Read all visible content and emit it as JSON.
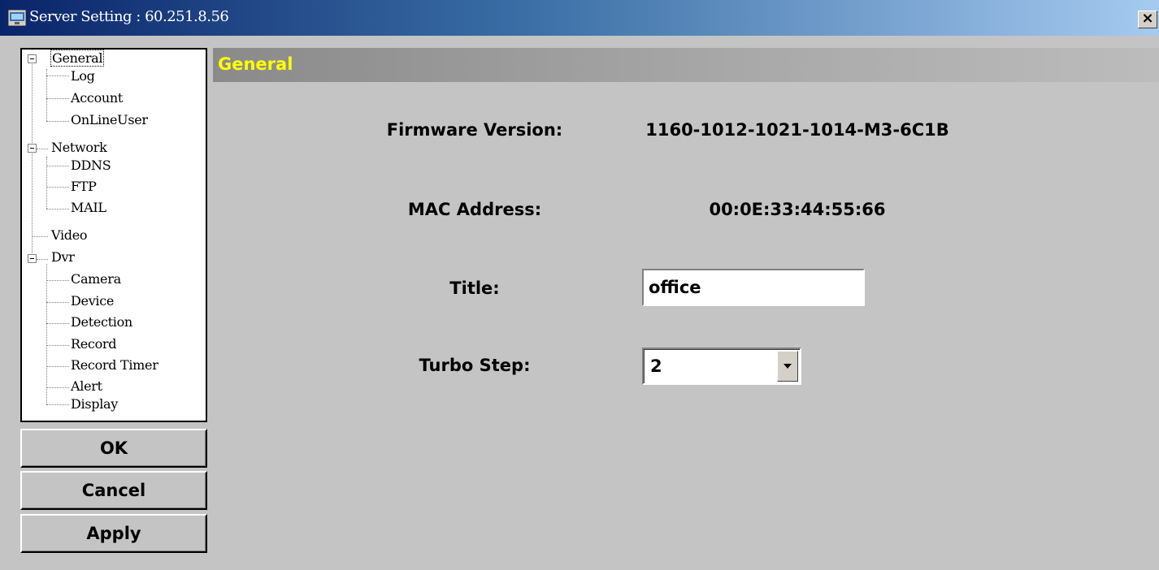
{
  "window": {
    "title": "Server Setting : 60.251.8.56",
    "close_glyph": "×"
  },
  "tree": {
    "items": [
      {
        "label": "General",
        "level": 0,
        "expandable": true,
        "selected": true
      },
      {
        "label": "Log",
        "level": 1
      },
      {
        "label": "Account",
        "level": 1
      },
      {
        "label": "OnLineUser",
        "level": 1
      },
      {
        "label": "Network",
        "level": 0,
        "expandable": true
      },
      {
        "label": "DDNS",
        "level": 1
      },
      {
        "label": "FTP",
        "level": 1
      },
      {
        "label": "MAIL",
        "level": 1
      },
      {
        "label": "Video",
        "level": 0
      },
      {
        "label": "Dvr",
        "level": 0,
        "expandable": true
      },
      {
        "label": "Camera",
        "level": 1
      },
      {
        "label": "Device",
        "level": 1
      },
      {
        "label": "Detection",
        "level": 1
      },
      {
        "label": "Record",
        "level": 1
      },
      {
        "label": "Record Timer",
        "level": 1
      },
      {
        "label": "Alert",
        "level": 1
      },
      {
        "label": "Display",
        "level": 1
      }
    ]
  },
  "buttons": {
    "ok": "OK",
    "cancel": "Cancel",
    "apply": "Apply"
  },
  "panel": {
    "header": "General",
    "firmware_label": "Firmware Version:",
    "firmware_value": "1160-1012-1021-1014-M3-6C1B",
    "mac_label": "MAC Address:",
    "mac_value": "00:0E:33:44:55:66",
    "title_label": "Title:",
    "title_value": "office",
    "turbo_label": "Turbo Step:",
    "turbo_value": "2"
  },
  "icons": {
    "app": "server-setting-icon",
    "close": "close-icon",
    "expander": "collapse-icon",
    "dropdown": "chevron-down-icon"
  },
  "colors": {
    "title_bar_start": "#0a246a",
    "title_bar_end": "#a6caf0",
    "header_text": "#ffff00",
    "background": "#c4c4c4"
  }
}
